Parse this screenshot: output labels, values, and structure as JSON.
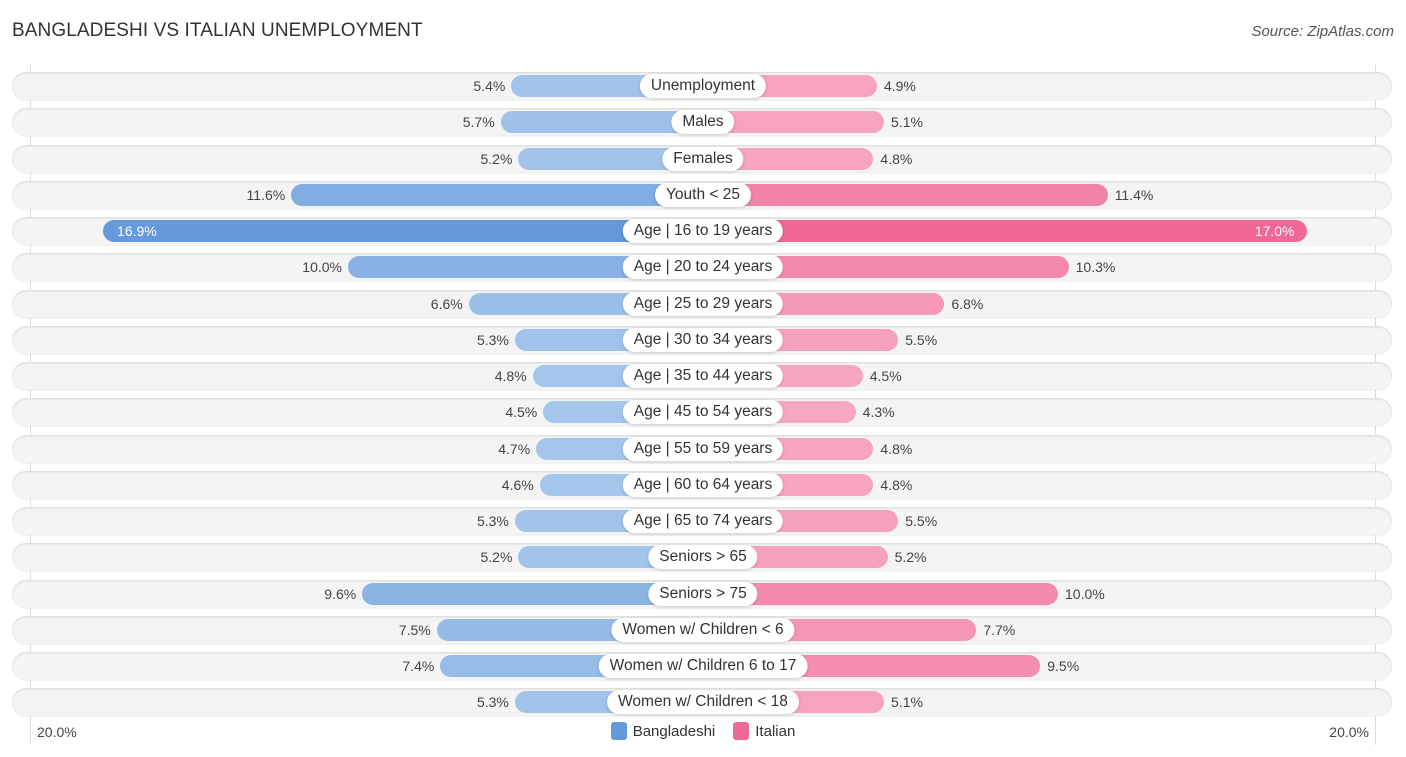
{
  "header": {
    "title": "BANGLADESHI VS ITALIAN UNEMPLOYMENT",
    "source": "Source: ZipAtlas.com"
  },
  "colors": {
    "bangladeshi_strong": "#6499da",
    "bangladeshi_light": "#a8c8ec",
    "italian_strong": "#f06895",
    "italian_light": "#f7a8c1"
  },
  "legend": [
    {
      "label": "Bangladeshi",
      "color": "#6499da"
    },
    {
      "label": "Italian",
      "color": "#f06895"
    }
  ],
  "axis": {
    "left_label": "20.0%",
    "right_label": "20.0%"
  },
  "chart_data": {
    "type": "bar",
    "orientation": "horizontal-diverging",
    "title": "BANGLADESHI VS ITALIAN UNEMPLOYMENT",
    "xlabel": "",
    "ylabel": "",
    "xlim": [
      -20,
      20
    ],
    "unit": "%",
    "categories": [
      "Unemployment",
      "Males",
      "Females",
      "Youth < 25",
      "Age | 16 to 19 years",
      "Age | 20 to 24 years",
      "Age | 25 to 29 years",
      "Age | 30 to 34 years",
      "Age | 35 to 44 years",
      "Age | 45 to 54 years",
      "Age | 55 to 59 years",
      "Age | 60 to 64 years",
      "Age | 65 to 74 years",
      "Seniors > 65",
      "Seniors > 75",
      "Women w/ Children < 6",
      "Women w/ Children 6 to 17",
      "Women w/ Children < 18"
    ],
    "series": [
      {
        "name": "Bangladeshi",
        "side": "left",
        "values": [
          5.4,
          5.7,
          5.2,
          11.6,
          16.9,
          10.0,
          6.6,
          5.3,
          4.8,
          4.5,
          4.7,
          4.6,
          5.3,
          5.2,
          9.6,
          7.5,
          7.4,
          5.3
        ],
        "labels": [
          "5.4%",
          "5.7%",
          "5.2%",
          "11.6%",
          "16.9%",
          "10.0%",
          "6.6%",
          "5.3%",
          "4.8%",
          "4.5%",
          "4.7%",
          "4.6%",
          "5.3%",
          "5.2%",
          "9.6%",
          "7.5%",
          "7.4%",
          "5.3%"
        ]
      },
      {
        "name": "Italian",
        "side": "right",
        "values": [
          4.9,
          5.1,
          4.8,
          11.4,
          17.0,
          10.3,
          6.8,
          5.5,
          4.5,
          4.3,
          4.8,
          4.8,
          5.5,
          5.2,
          10.0,
          7.7,
          9.5,
          5.1
        ],
        "labels": [
          "4.9%",
          "5.1%",
          "4.8%",
          "11.4%",
          "17.0%",
          "10.3%",
          "6.8%",
          "5.5%",
          "4.5%",
          "4.3%",
          "4.8%",
          "4.8%",
          "5.5%",
          "5.2%",
          "10.0%",
          "7.7%",
          "9.5%",
          "5.1%"
        ]
      }
    ],
    "legend_position": "bottom-center",
    "grid": false
  }
}
